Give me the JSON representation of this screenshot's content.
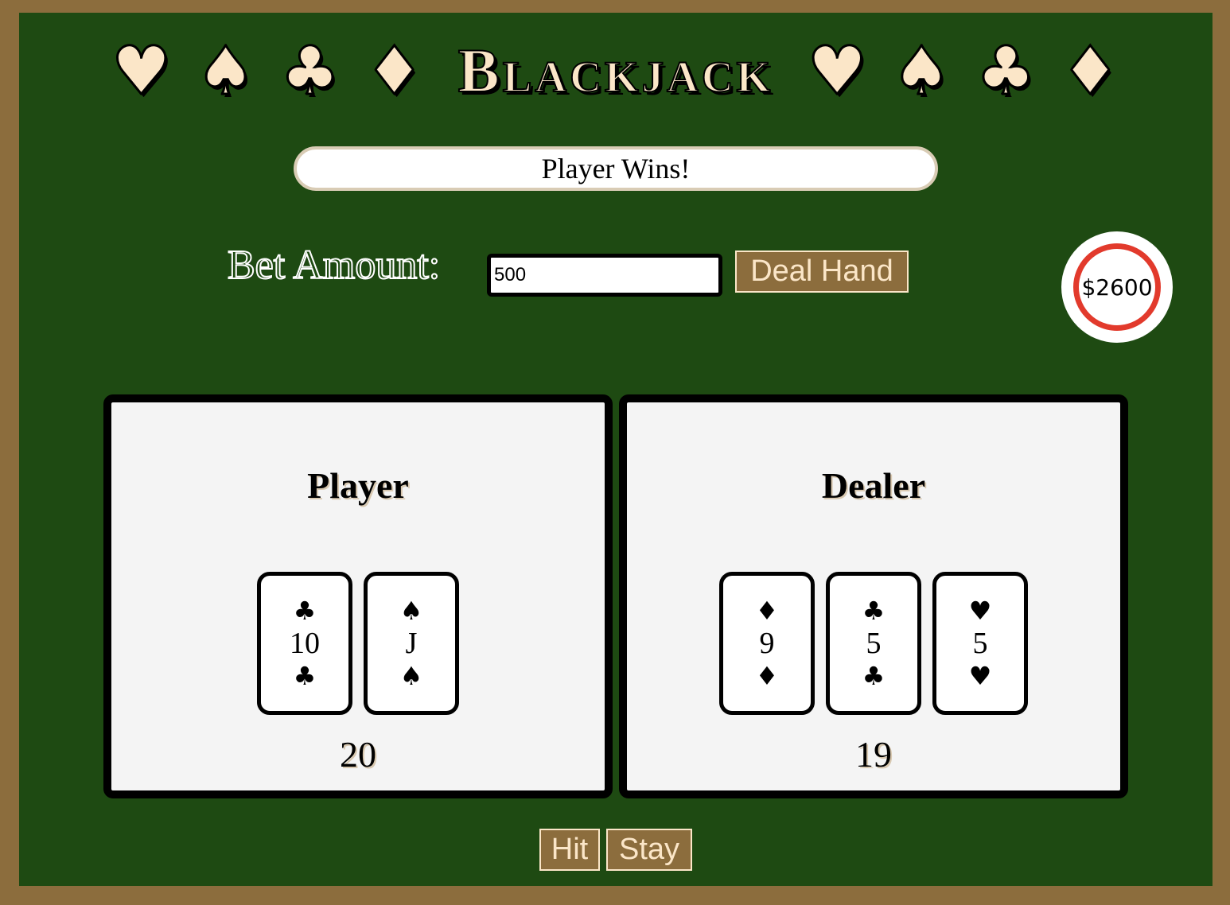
{
  "header": {
    "suits_left": [
      "♥",
      "♠",
      "♣",
      "♦"
    ],
    "title": "Blackjack",
    "suits_right": [
      "♥",
      "♠",
      "♣",
      "♦"
    ]
  },
  "status": {
    "message": "Player Wins!"
  },
  "bet": {
    "label": "Bet Amount:",
    "value": "500",
    "deal_label": "Deal Hand"
  },
  "bank": {
    "amount": "$2600"
  },
  "player": {
    "title": "Player",
    "cards": [
      {
        "rank": "10",
        "suit": "♣"
      },
      {
        "rank": "J",
        "suit": "♠"
      }
    ],
    "score": "20"
  },
  "dealer": {
    "title": "Dealer",
    "cards": [
      {
        "rank": "9",
        "suit": "♦"
      },
      {
        "rank": "5",
        "suit": "♣"
      },
      {
        "rank": "5",
        "suit": "♥"
      }
    ],
    "score": "19"
  },
  "actions": {
    "hit_label": "Hit",
    "stay_label": "Stay"
  },
  "colors": {
    "felt": "#1e4a12",
    "frame": "#8c6d3d",
    "cream": "#fbe6c8",
    "chip_ring": "#e23a2c"
  }
}
